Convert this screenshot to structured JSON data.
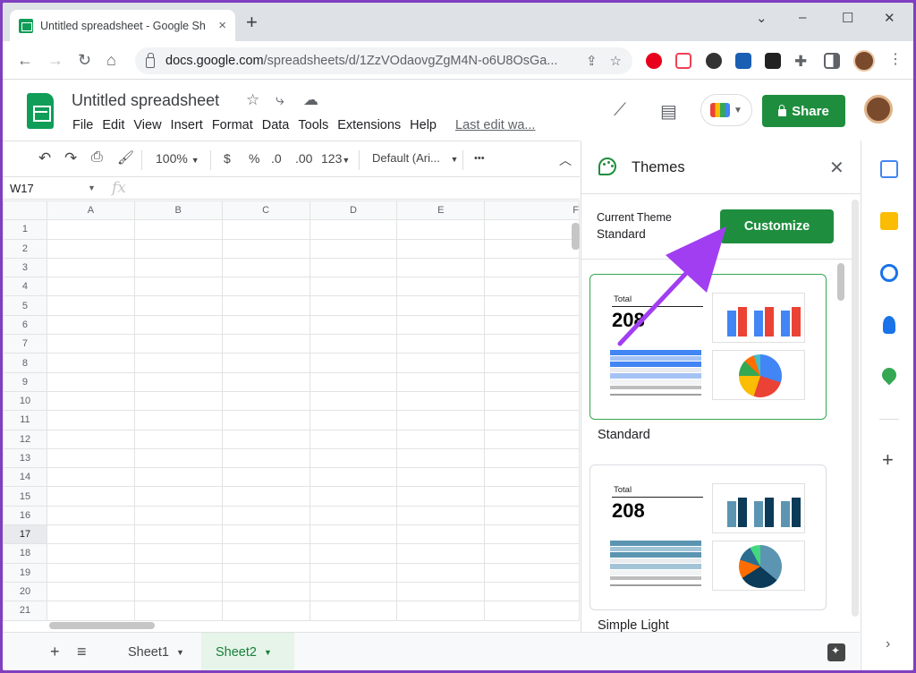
{
  "browser": {
    "tab_title": "Untitled spreadsheet - Google Sh",
    "tab_close": "×",
    "new_tab": "+",
    "window_controls": [
      "⌄",
      "–",
      "☐",
      "✕"
    ],
    "url_host": "docs.google.com",
    "url_path": "/spreadsheets/d/1ZzVOdaovgZgM4N-o6U8OsGa...",
    "nav": [
      "←",
      "→",
      "↻",
      "⌂"
    ]
  },
  "app": {
    "doc_title": "Untitled spreadsheet",
    "menu": [
      "File",
      "Edit",
      "View",
      "Insert",
      "Format",
      "Data",
      "Tools",
      "Extensions",
      "Help"
    ],
    "last_edit": "Last edit wa...",
    "share_label": "Share"
  },
  "format_toolbar": {
    "zoom": "100%",
    "currency": "$",
    "percent": "%",
    "dec_decrease": ".0",
    "dec_increase": ".00",
    "more_formats": "123",
    "font": "Default (Ari...",
    "more": "•••"
  },
  "formula_bar": {
    "cell_ref": "W17",
    "fx": "fx"
  },
  "grid": {
    "columns": [
      "A",
      "B",
      "C",
      "D",
      "E",
      "F"
    ],
    "rows": [
      "1",
      "2",
      "3",
      "4",
      "5",
      "6",
      "7",
      "8",
      "9",
      "10",
      "11",
      "12",
      "13",
      "14",
      "15",
      "16",
      "17",
      "18",
      "19",
      "20",
      "21"
    ],
    "selected_row": "17"
  },
  "sheets": {
    "tabs": [
      "Sheet1",
      "Sheet2"
    ],
    "active": "Sheet2"
  },
  "themes_panel": {
    "title": "Themes",
    "current_label": "Current Theme",
    "current_value": "Standard",
    "customize_label": "Customize",
    "cards": [
      {
        "name": "Standard",
        "total_label": "Total",
        "total_value": "208",
        "bar_colors": [
          "#4285f4",
          "#ea4335"
        ],
        "table_colors": [
          "#4285f4",
          "#a4c2f4"
        ],
        "pie_colors": [
          "#4285f4",
          "#ea4335",
          "#fbbc04",
          "#34a853",
          "#ff6d01",
          "#46bdc6"
        ],
        "selected": true
      },
      {
        "name": "Simple Light",
        "total_label": "Total",
        "total_value": "208",
        "bar_colors": [
          "#5b95b2",
          "#0b3b58"
        ],
        "table_colors": [
          "#5b95b2",
          "#a2c4d6"
        ],
        "pie_colors": [
          "#5b95b2",
          "#0b3b58",
          "#ff6d01",
          "#2b6d8f",
          "#43d87d"
        ],
        "selected": false
      }
    ]
  },
  "colors": {
    "accent_green": "#1e8e3e",
    "annotation_purple": "#a23ef2"
  }
}
